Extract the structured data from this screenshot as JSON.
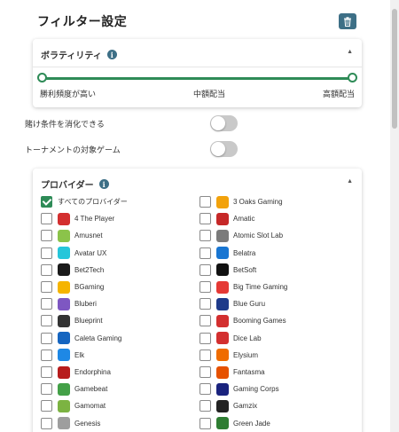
{
  "header": {
    "title": "フィルター設定"
  },
  "volatility": {
    "title": "ボラティリティ",
    "labels": {
      "left": "勝利頻度が高い",
      "center": "中額配当",
      "right": "高額配当"
    },
    "value_range": [
      0,
      1
    ]
  },
  "toggles": [
    {
      "label": "賭け条件を消化できる",
      "on": false
    },
    {
      "label": "トーナメントの対象ゲーム",
      "on": false
    }
  ],
  "providers": {
    "title": "プロバイダー",
    "items": [
      {
        "name": "すべてのプロバイダー",
        "checked": true,
        "logo": "",
        "color": ""
      },
      {
        "name": "3 Oaks Gaming",
        "checked": false,
        "logo": "oak-icon",
        "color": "#f2a20c"
      },
      {
        "name": "4 The Player",
        "checked": false,
        "logo": "4-the-player-icon",
        "color": "#d32f2f"
      },
      {
        "name": "Amatic",
        "checked": false,
        "logo": "amatic-icon",
        "color": "#c62828"
      },
      {
        "name": "Amusnet",
        "checked": false,
        "logo": "amusnet-icon",
        "color": "#8bc34a"
      },
      {
        "name": "Atomic Slot Lab",
        "checked": false,
        "logo": "atomic-icon",
        "color": "#7b7b7b"
      },
      {
        "name": "Avatar UX",
        "checked": false,
        "logo": "avatar-ux-icon",
        "color": "#26c6da"
      },
      {
        "name": "Belatra",
        "checked": false,
        "logo": "belatra-icon",
        "color": "#1976d2"
      },
      {
        "name": "Bet2Tech",
        "checked": false,
        "logo": "bet2tech-icon",
        "color": "#1a1a1a"
      },
      {
        "name": "BetSoft",
        "checked": false,
        "logo": "betsoft-icon",
        "color": "#111111"
      },
      {
        "name": "BGaming",
        "checked": false,
        "logo": "bgaming-icon",
        "color": "#f5b400"
      },
      {
        "name": "Big Time Gaming",
        "checked": false,
        "logo": "btg-icon",
        "color": "#e53935"
      },
      {
        "name": "Bluberi",
        "checked": false,
        "logo": "bluberi-icon",
        "color": "#7e57c2"
      },
      {
        "name": "Blue Guru",
        "checked": false,
        "logo": "blue-guru-icon",
        "color": "#1e3a8a"
      },
      {
        "name": "Blueprint",
        "checked": false,
        "logo": "blueprint-icon",
        "color": "#333333"
      },
      {
        "name": "Booming Games",
        "checked": false,
        "logo": "booming-icon",
        "color": "#d32f2f"
      },
      {
        "name": "Caleta Gaming",
        "checked": false,
        "logo": "caleta-icon",
        "color": "#1565c0"
      },
      {
        "name": "Dice Lab",
        "checked": false,
        "logo": "dice-lab-icon",
        "color": "#d32f2f"
      },
      {
        "name": "Elk",
        "checked": false,
        "logo": "elk-icon",
        "color": "#1e88e5"
      },
      {
        "name": "Elysium",
        "checked": false,
        "logo": "elysium-icon",
        "color": "#ef6c00"
      },
      {
        "name": "Endorphina",
        "checked": false,
        "logo": "endorphina-icon",
        "color": "#b71c1c"
      },
      {
        "name": "Fantasma",
        "checked": false,
        "logo": "fantasma-icon",
        "color": "#e65100"
      },
      {
        "name": "Gamebeat",
        "checked": false,
        "logo": "gamebeat-icon",
        "color": "#43a047"
      },
      {
        "name": "Gaming Corps",
        "checked": false,
        "logo": "gaming-corps-icon",
        "color": "#1a237e"
      },
      {
        "name": "Gamomat",
        "checked": false,
        "logo": "gamomat-icon",
        "color": "#7cb342"
      },
      {
        "name": "Gamzix",
        "checked": false,
        "logo": "gamzix-icon",
        "color": "#222222"
      },
      {
        "name": "Genesis",
        "checked": false,
        "logo": "genesis-icon",
        "color": "#9e9e9e"
      },
      {
        "name": "Green Jade",
        "checked": false,
        "logo": "green-jade-icon",
        "color": "#2e7d32"
      }
    ]
  }
}
